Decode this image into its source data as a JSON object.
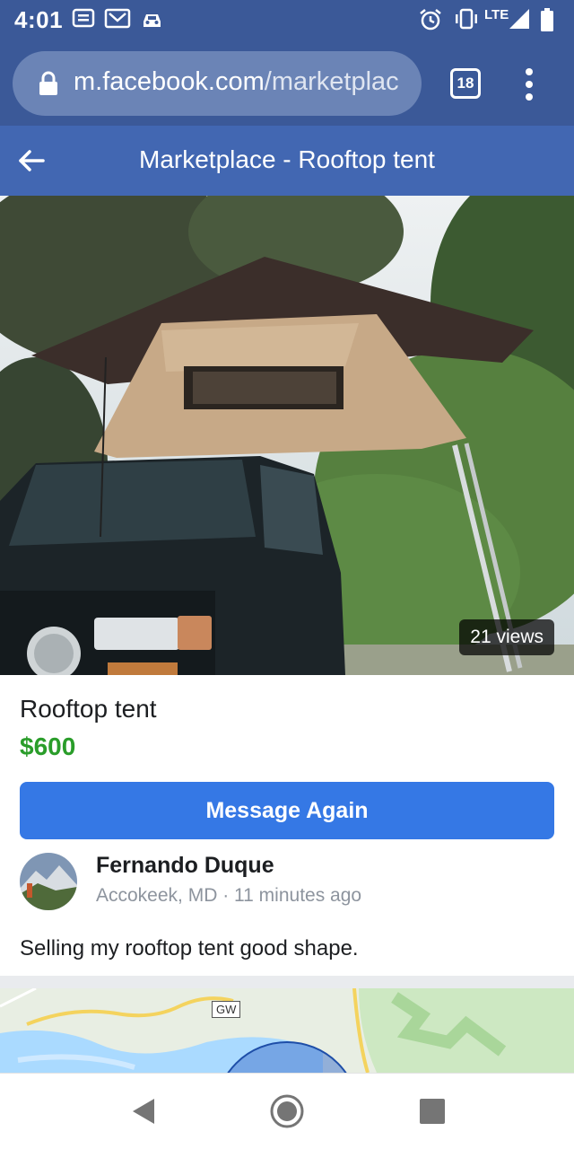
{
  "status_bar": {
    "time": "4:01",
    "network_label": "LTE",
    "icons": [
      "sms-icon",
      "gmail-icon",
      "car-icon",
      "alarm-icon",
      "vibrate-icon",
      "signal-icon",
      "battery-icon"
    ]
  },
  "browser": {
    "url_host": "m.facebook.com",
    "url_path": "/marketplac",
    "tab_count": "18",
    "icons": [
      "lock-icon",
      "tabs-icon",
      "overflow-menu-icon"
    ]
  },
  "header": {
    "title": "Marketplace - Rooftop tent",
    "icons": [
      "back-arrow-icon"
    ]
  },
  "photo": {
    "views": "21 views"
  },
  "listing": {
    "title": "Rooftop tent",
    "price": "$600",
    "message_button": "Message Again",
    "seller_name": "Fernando Duque",
    "seller_location": "Accokeek, MD",
    "posted_time": "11 minutes ago",
    "description": "Selling my rooftop tent good shape."
  },
  "map": {
    "road_label": "GW"
  },
  "colors": {
    "facebook_blue": "#3b5998",
    "header_blue": "#4267b2",
    "button_blue": "#3578e5",
    "price_green": "#2a9d2a"
  },
  "nav_bar": {
    "icons": [
      "back-triangle-icon",
      "home-circle-icon",
      "recents-square-icon"
    ]
  }
}
